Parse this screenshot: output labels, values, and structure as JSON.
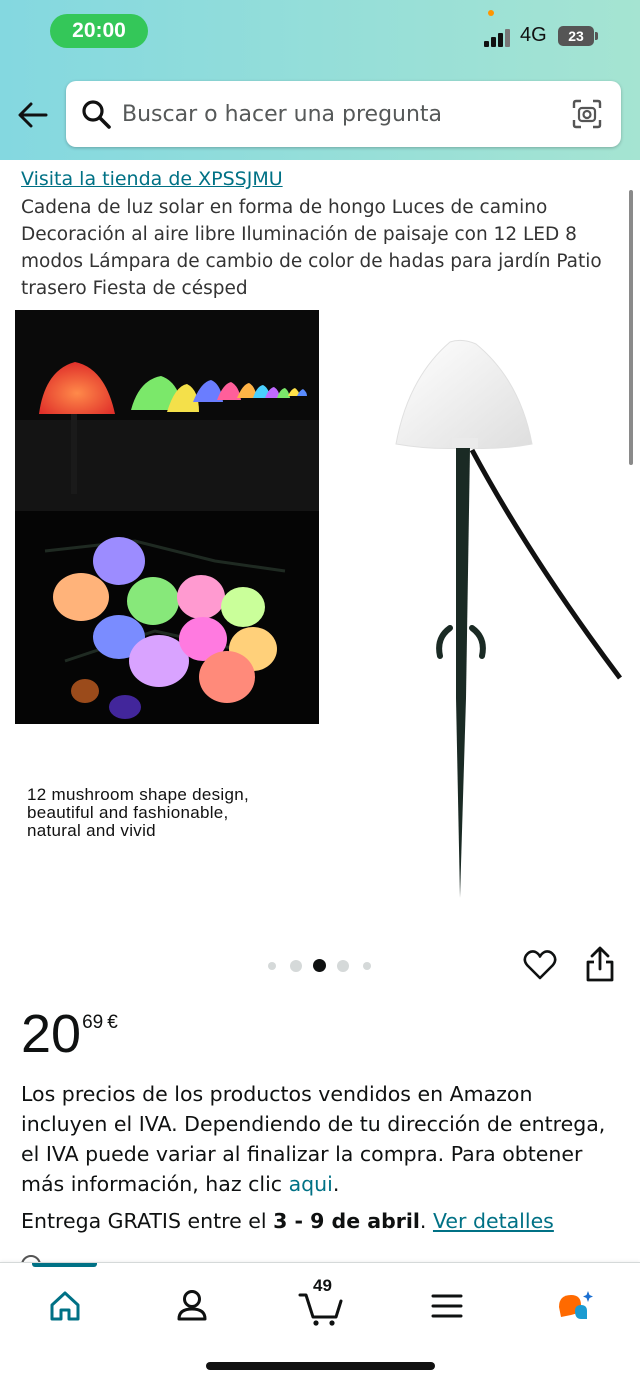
{
  "status_bar": {
    "time": "20:00",
    "network": "4G",
    "battery": "23"
  },
  "search": {
    "placeholder": "Buscar o hacer una pregunta"
  },
  "product": {
    "store_link": "Visita la tienda de XPSSJMU",
    "title": "Cadena de luz solar en forma de hongo Luces de camino Decoración al aire libre Iluminación de paisaje con 12 LED 8 modos Lámpara de cambio de color de hadas para jardín Patio trasero Fiesta de césped",
    "image_caption_lines": [
      "12 mushroom shape design,",
      "beautiful and fashionable,",
      "natural and vivid"
    ],
    "image_count": 5,
    "active_image_index": 2
  },
  "price": {
    "whole": "20",
    "fraction": "69",
    "currency": "€"
  },
  "vat_notice": {
    "text": "Los precios de los productos vendidos en Amazon incluyen el IVA. Dependiendo de tu dirección de entrega, el IVA puede variar al finalizar la compra. Para obtener más información, haz clic ",
    "link": "aqui",
    "end": "."
  },
  "delivery": {
    "prefix": "Entrega GRATIS entre el ",
    "dates": "3 - 9 de abril",
    "suffix": ". ",
    "details_link": "Ver detalles"
  },
  "bottom_nav": {
    "cart_count": "49",
    "active": "home"
  },
  "colors": {
    "link": "#007185",
    "header_gradient_start": "#84d8e0",
    "header_gradient_end": "#a5e4d2",
    "status_green": "#34c759",
    "rufus_orange": "#ff6a00",
    "rufus_teal": "#1b9bd1"
  }
}
